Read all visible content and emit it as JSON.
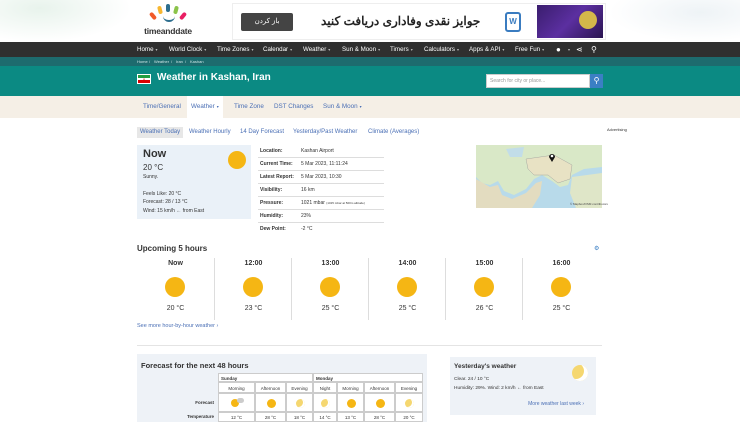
{
  "ad": {
    "button": "باز کردن",
    "headline": "جوایز نقدی وفاداری دریافت کنید"
  },
  "logo": {
    "text": "timeanddate"
  },
  "nav": {
    "items": [
      "Home",
      "World Clock",
      "Time Zones",
      "Calendar",
      "Weather",
      "Sun & Moon",
      "Timers",
      "Calculators",
      "Apps & API",
      "Free Fun"
    ]
  },
  "breadcrumb": [
    "Home",
    "Weather",
    "Iran",
    "Kashan"
  ],
  "hero": {
    "title": "Weather in Kashan, Iran",
    "search_placeholder": "Search for city or place..."
  },
  "tabs": [
    "Time/General",
    "Weather",
    "Time Zone",
    "DST Changes",
    "Sun & Moon"
  ],
  "subtabs": [
    "Weather Today",
    "Weather Hourly",
    "14 Day Forecast",
    "Yesterday/Past Weather",
    "Climate (Averages)"
  ],
  "advertising": "Advertising",
  "now": {
    "title": "Now",
    "temp": "20 °C",
    "desc": "Sunny.",
    "feels": "Feels Like: 20 °C",
    "forecast": "Forecast: 28 / 13 °C",
    "wind": "Wind: 15 km/h",
    "wind_dir": "from East"
  },
  "details": [
    {
      "k": "Location:",
      "v": "Kashan Airport"
    },
    {
      "k": "Current Time:",
      "v": "5 Mar 2023, 11:11:24"
    },
    {
      "k": "Latest Report:",
      "v": "5 Mar 2023, 10:30"
    },
    {
      "k": "Visibility:",
      "v": "16 km"
    },
    {
      "k": "Pressure:",
      "v": "1021 mbar",
      "note": "(1015 mbar at 500m altitude)"
    },
    {
      "k": "Humidity:",
      "v": "23%"
    },
    {
      "k": "Dew Point:",
      "v": "-2 °C"
    }
  ],
  "map_credit": "© Mapbox/OSM contributors",
  "upcoming": {
    "title": "Upcoming 5 hours",
    "hours": [
      {
        "t": "Now",
        "c": "20 °C"
      },
      {
        "t": "12:00",
        "c": "23 °C"
      },
      {
        "t": "13:00",
        "c": "25 °C"
      },
      {
        "t": "14:00",
        "c": "25 °C"
      },
      {
        "t": "15:00",
        "c": "26 °C"
      },
      {
        "t": "16:00",
        "c": "25 °C"
      }
    ],
    "more": "See more hour-by-hour weather"
  },
  "forecast48": {
    "title": "Forecast for the next 48 hours",
    "days": [
      "Sunday",
      "Monday"
    ],
    "periods": [
      "Morning",
      "Afternoon",
      "Evening",
      "Night",
      "Morning",
      "Afternoon",
      "Evening"
    ],
    "row_forecast": "Forecast",
    "row_temp": "Temperature",
    "temps": [
      "12 °C",
      "28 °C",
      "18 °C",
      "14 °C",
      "13 °C",
      "28 °C",
      "20 °C"
    ]
  },
  "yesterday": {
    "title": "Yesterday's weather",
    "line1": "Clear. 24 / 10 °C",
    "line2": "Humidity: 29%. Wind: 2 km/h",
    "line2_dir": "from East",
    "more": "More weather last week"
  }
}
